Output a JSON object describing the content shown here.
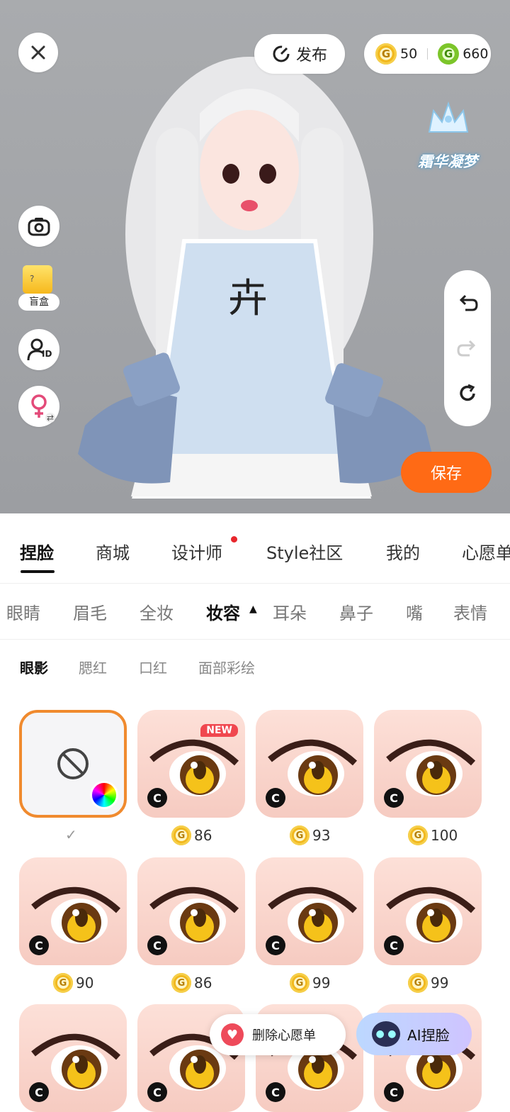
{
  "header": {
    "publish_label": "发布",
    "gold_coins": "50",
    "green_coins": "660",
    "coin_glyph": "G",
    "title_badge": "霜华凝梦"
  },
  "side_tools": {
    "blindbox_label": "盲盒",
    "id_label": "ID"
  },
  "save_label": "保存",
  "main_tabs": [
    "捏脸",
    "商城",
    "设计师",
    "Style社区",
    "我的",
    "心愿单"
  ],
  "sub_tabs": [
    "眼睛",
    "眉毛",
    "全妆",
    "妆容",
    "耳朵",
    "鼻子",
    "嘴",
    "表情"
  ],
  "third_tabs": [
    "眼影",
    "腮红",
    "口红",
    "面部彩绘"
  ],
  "items": [
    {
      "type": "none",
      "price": ""
    },
    {
      "type": "item",
      "price": "86",
      "new": "NEW"
    },
    {
      "type": "item",
      "price": "93"
    },
    {
      "type": "item",
      "price": "100"
    },
    {
      "type": "item",
      "price": "90"
    },
    {
      "type": "item",
      "price": "86"
    },
    {
      "type": "item",
      "price": "99"
    },
    {
      "type": "item",
      "price": "99"
    },
    {
      "type": "item",
      "price": ""
    },
    {
      "type": "item",
      "price": ""
    },
    {
      "type": "item",
      "price": ""
    },
    {
      "type": "item",
      "price": ""
    }
  ],
  "c_badge": "C",
  "bottom": {
    "wishlist_label": "删除心愿单",
    "ai_label": "AI捏脸"
  },
  "colors": {
    "accent": "#ff6a15",
    "selected_border": "#f08a2e",
    "notification_dot": "#e8262c"
  }
}
